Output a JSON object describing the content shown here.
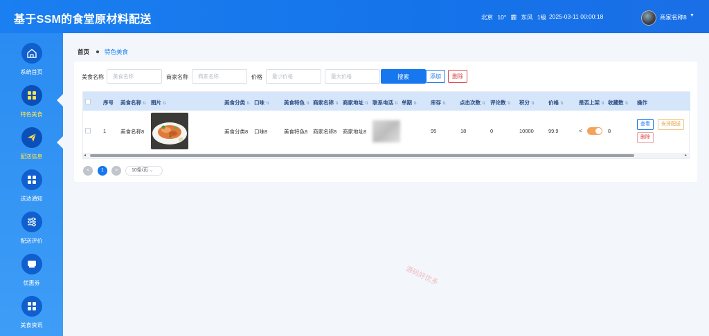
{
  "header": {
    "title": "基于SSM的食堂原材料配送",
    "weather": {
      "city": "北京",
      "temp": "10°",
      "condition": "霾",
      "wind": "东风",
      "level": "1级"
    },
    "datetime": "2025-03-11 00:00:18",
    "username": "商家名称8",
    "caret": "▼"
  },
  "sidebar": {
    "items": [
      {
        "label": "系统首页",
        "icon": "home-icon"
      },
      {
        "label": "特色美食",
        "icon": "grid-icon"
      },
      {
        "label": "配送信息",
        "icon": "paper-plane-icon"
      },
      {
        "label": "送达通知",
        "icon": "grid-icon"
      },
      {
        "label": "配送评价",
        "icon": "sliders-icon"
      },
      {
        "label": "优惠券",
        "icon": "coupon-icon"
      },
      {
        "label": "美食资讯",
        "icon": "grid-icon"
      }
    ]
  },
  "breadcrumb": {
    "home": "首页",
    "current": "特色美食"
  },
  "search": {
    "food_name_label": "美食名称",
    "food_name_placeholder": "美食名称",
    "merchant_label": "商家名称",
    "merchant_placeholder": "商家名称",
    "price_label": "价格",
    "min_price_placeholder": "最小价格",
    "max_price_placeholder": "最大价格",
    "search_button": "搜索",
    "add_button": "添加",
    "delete_button": "删除"
  },
  "table": {
    "headers": [
      "序号",
      "美食名称",
      "图片",
      "美食分类",
      "口味",
      "美食特色",
      "商家名称",
      "商家地址",
      "联系电话",
      "单期",
      "库存",
      "点击次数",
      "评论数",
      "积分",
      "价格",
      "是否上架",
      "收藏数",
      "操作"
    ],
    "row": {
      "index": "1",
      "name": "美食名称8",
      "category": "美食分类8",
      "taste": "口味8",
      "feature": "美食特色8",
      "merchant": "商家名称8",
      "address": "商家地址8",
      "stock": "95",
      "clicks": "18",
      "comments": "0",
      "points": "10000",
      "price": "99.9",
      "favorites": "8",
      "on_shelf": true,
      "actions": {
        "view": "查看",
        "arrange": "安排配送",
        "delete": "删除"
      }
    }
  },
  "pagination": {
    "current": "1",
    "prev": "<",
    "next": ">",
    "page_size": "10条/页"
  },
  "watermark": "源码好优多",
  "colors": {
    "primary": "#1677ee",
    "header": "#1a7ff0",
    "danger": "#e04545",
    "switch_on": "#f3a35a",
    "warning": "#e6a23c"
  }
}
